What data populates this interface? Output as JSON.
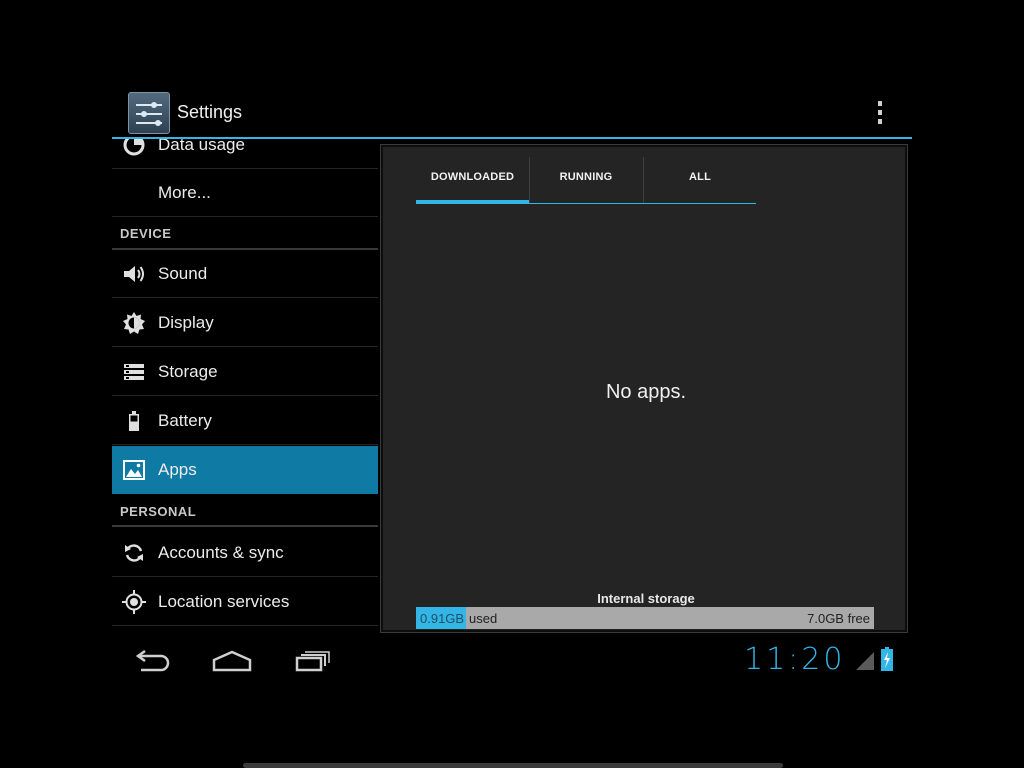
{
  "window": {
    "title": "Settings"
  },
  "action_bar": {
    "icons": [
      "settings-sliders-icon",
      "overflow-menu-icon"
    ]
  },
  "settings_list": {
    "items": [
      {
        "id": "data-usage",
        "label": "Data usage",
        "icon": "data-usage-icon"
      },
      {
        "id": "more",
        "label": "More...",
        "icon": ""
      },
      {
        "id": "sound",
        "label": "Sound",
        "icon": "speaker-icon"
      },
      {
        "id": "display",
        "label": "Display",
        "icon": "brightness-icon"
      },
      {
        "id": "storage",
        "label": "Storage",
        "icon": "storage-icon"
      },
      {
        "id": "battery",
        "label": "Battery",
        "icon": "battery-icon"
      },
      {
        "id": "apps",
        "label": "Apps",
        "icon": "apps-icon",
        "selected": true
      },
      {
        "id": "accounts-sync",
        "label": "Accounts & sync",
        "icon": "sync-icon"
      },
      {
        "id": "location",
        "label": "Location services",
        "icon": "location-icon"
      }
    ],
    "sections": {
      "device": "DEVICE",
      "personal": "PERSONAL"
    }
  },
  "apps_panel": {
    "tabs": [
      {
        "label": "DOWNLOADED",
        "selected": true
      },
      {
        "label": "RUNNING",
        "selected": false
      },
      {
        "label": "ALL",
        "selected": false
      }
    ],
    "empty_message": "No apps.",
    "storage": {
      "title": "Internal storage",
      "used_amount": "0.91GB",
      "used_word": "used",
      "free_text": "7.0GB free",
      "used_fraction": 0.11
    }
  },
  "system_bar": {
    "nav_buttons": [
      "back-icon",
      "home-icon",
      "recent-apps-icon"
    ],
    "clock": "11:20",
    "status_icons": [
      "signal-icon",
      "battery-charging-icon"
    ]
  },
  "colors": {
    "accent": "#33b5e5",
    "selected_row": "#0f7aa3",
    "panel": "#242424",
    "background": "#000000"
  }
}
